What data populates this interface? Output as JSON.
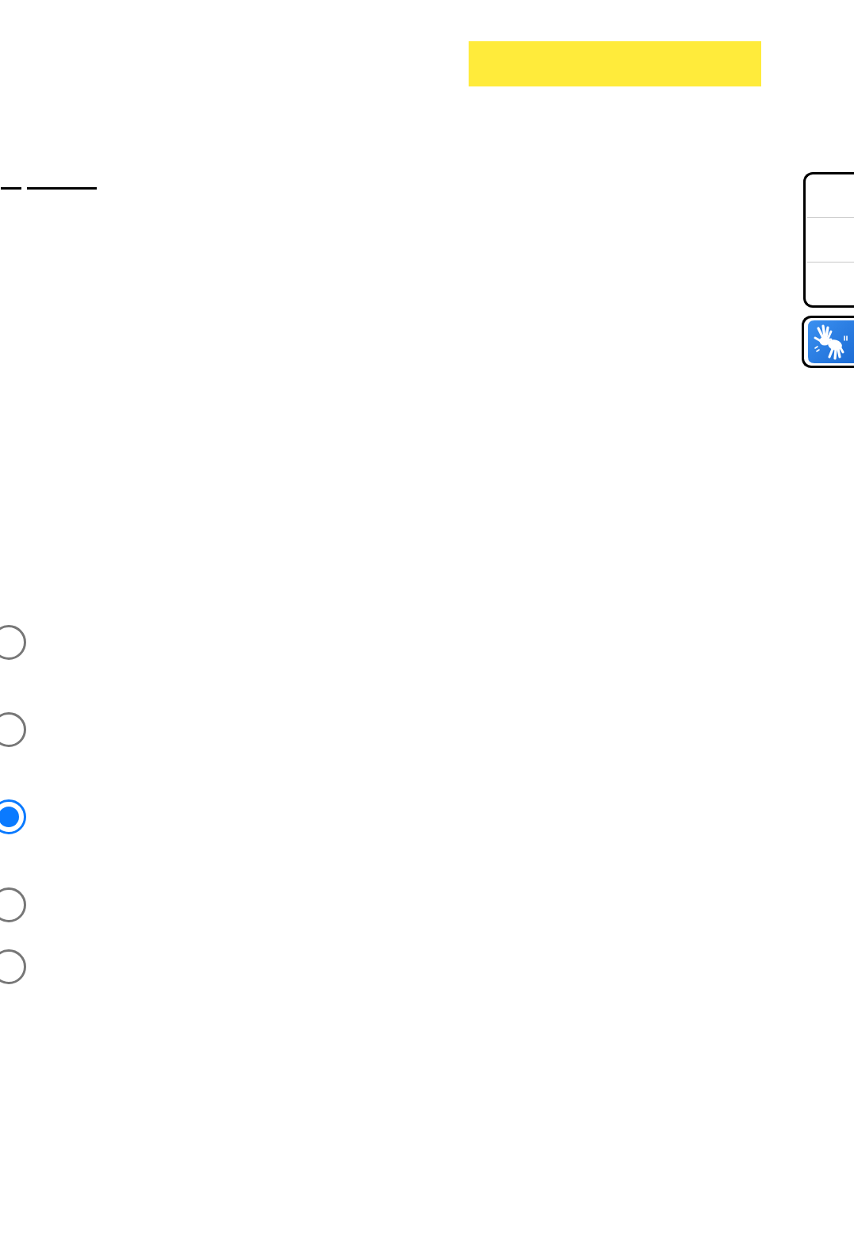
{
  "radio_buttons": [
    {
      "selected": false
    },
    {
      "selected": false
    },
    {
      "selected": true
    },
    {
      "selected": false
    },
    {
      "selected": false
    }
  ]
}
